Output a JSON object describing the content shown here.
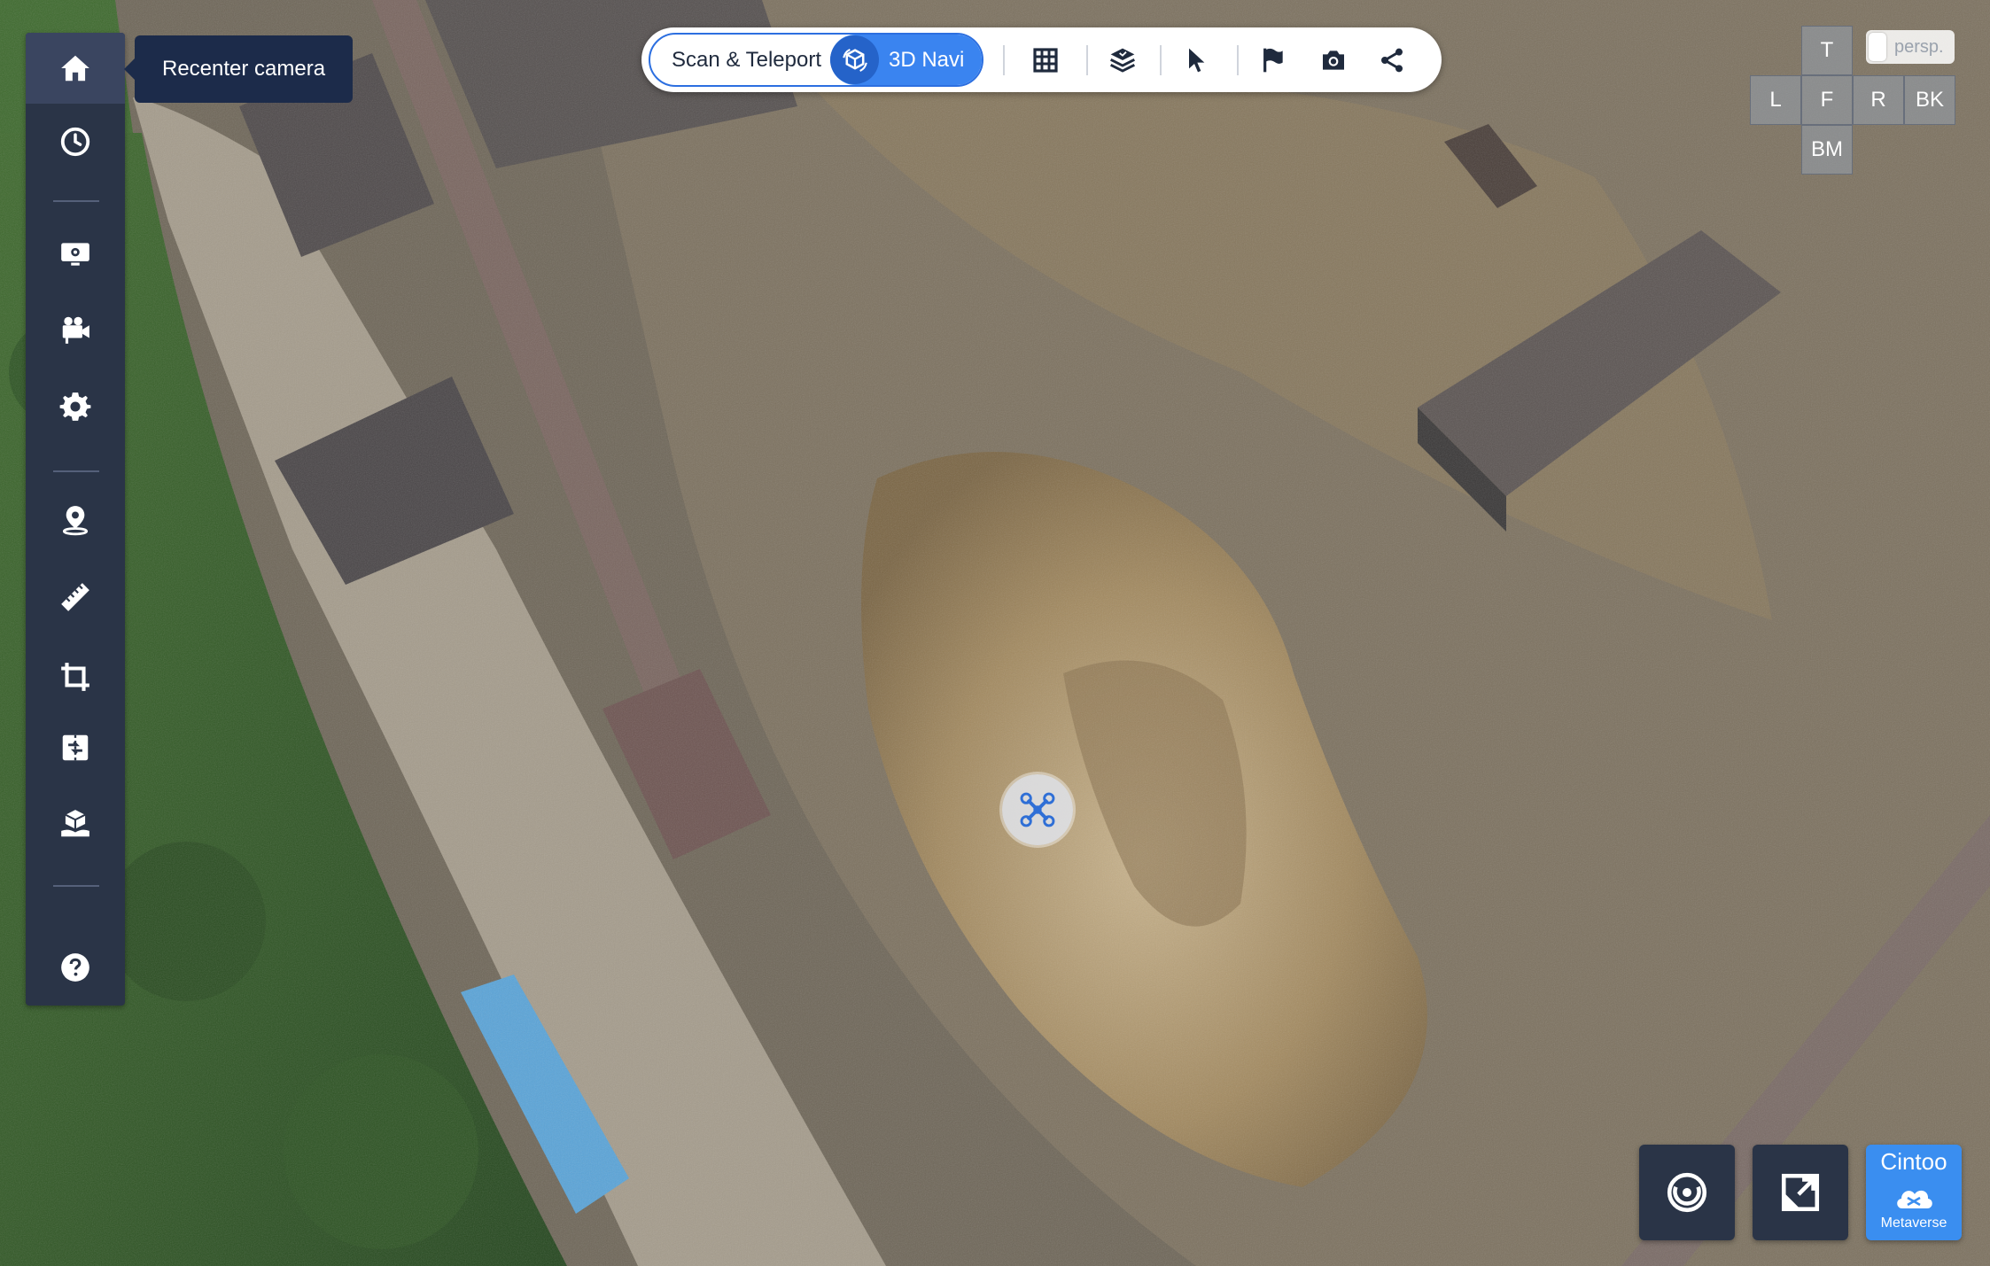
{
  "left_toolbar": {
    "items": [
      {
        "name": "home",
        "icon": "home-icon"
      },
      {
        "name": "history",
        "icon": "clock-icon"
      },
      {
        "name": "presentation",
        "icon": "monitor-gear-icon"
      },
      {
        "name": "camera-path",
        "icon": "video-camera-icon"
      },
      {
        "name": "settings",
        "icon": "gear-icon"
      },
      {
        "name": "location",
        "icon": "location-pin-icon"
      },
      {
        "name": "measure",
        "icon": "ruler-icon"
      },
      {
        "name": "crop",
        "icon": "crop-icon"
      },
      {
        "name": "compare",
        "icon": "compare-icon"
      },
      {
        "name": "model",
        "icon": "cube-hand-icon"
      },
      {
        "name": "help",
        "icon": "help-icon"
      }
    ],
    "tooltip": "Recenter camera"
  },
  "top_toolbar": {
    "scan_teleport_label": "Scan & Teleport",
    "navi_label": "3D Navi",
    "tools": [
      "grid-icon",
      "layers-icon",
      "pointer-icon",
      "flag-icon",
      "camera-icon",
      "share-icon"
    ]
  },
  "view_cube": {
    "top": "T",
    "left": "L",
    "front": "F",
    "right": "R",
    "back": "BK",
    "bottom": "BM",
    "persp_label": "persp."
  },
  "bottom_right": {
    "buttons": [
      "target-icon",
      "fullscreen-icon"
    ],
    "brand": "Cintoo",
    "brand_sub": "Metaverse"
  },
  "colors": {
    "toolbar_bg": "#2a3447",
    "accent": "#3a84f0",
    "tooltip_bg": "#1c2b4a"
  }
}
